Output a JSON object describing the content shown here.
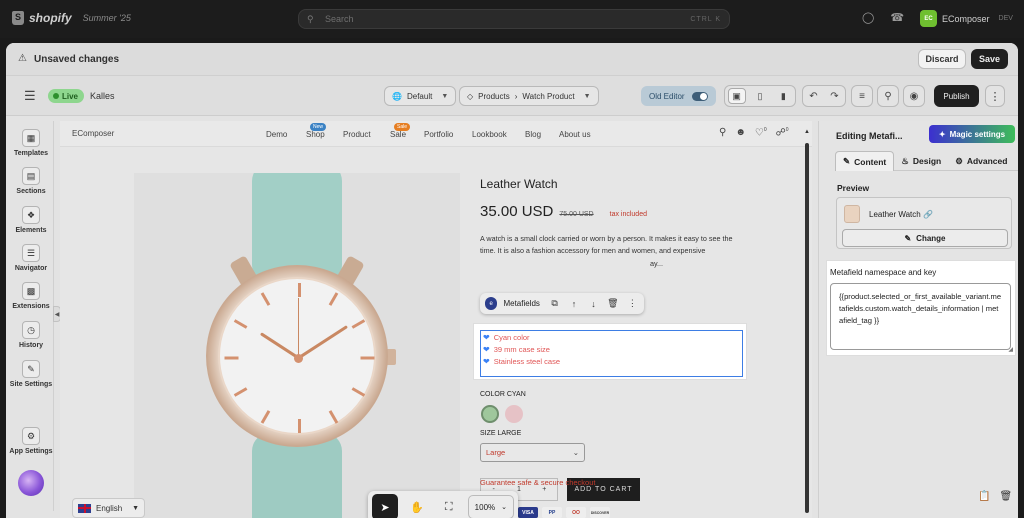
{
  "shopify": {
    "logo_text": "shopify",
    "logo_sub": "Summer '25",
    "search_placeholder": "Search",
    "search_hint": "CTRL K",
    "store_badge": "EC",
    "store_name": "EComposer",
    "store_sub": "DEV"
  },
  "unsaved": {
    "text": "Unsaved changes",
    "discard_label": "Discard",
    "save_label": "Save"
  },
  "toolbar": {
    "live_label": "Live",
    "theme_name": "Kalles",
    "template_label": "Default",
    "breadcrumb_type": "Products",
    "breadcrumb_page": "Watch Product",
    "old_editor_label": "Old Editor",
    "publish_label": "Publish"
  },
  "sidebar": {
    "items": [
      {
        "label": "Templates",
        "icon": "templates-icon"
      },
      {
        "label": "Sections",
        "icon": "sections-icon"
      },
      {
        "label": "Elements",
        "icon": "elements-icon"
      },
      {
        "label": "Navigator",
        "icon": "navigator-icon"
      },
      {
        "label": "Extensions",
        "icon": "extensions-icon"
      },
      {
        "label": "History",
        "icon": "history-icon"
      },
      {
        "label": "Site Settings",
        "icon": "site-settings-icon"
      },
      {
        "label": "App Settings",
        "icon": "app-settings-icon"
      }
    ]
  },
  "site": {
    "brand": "EComposer",
    "nav": [
      {
        "label": "Demo"
      },
      {
        "label": "Shop",
        "badge": "New",
        "badge_color": "#3b82c4"
      },
      {
        "label": "Product"
      },
      {
        "label": "Sale",
        "badge": "Sale",
        "badge_color": "#e67e22"
      },
      {
        "label": "Portfolio"
      },
      {
        "label": "Lookbook"
      },
      {
        "label": "Blog"
      },
      {
        "label": "About us"
      }
    ],
    "wishlist_count": "0",
    "cart_count": "0",
    "language": "English"
  },
  "product": {
    "title": "Leather Watch",
    "price": "35.00 USD",
    "old_price": "75.00 USD",
    "tax": "tax included",
    "description": "A watch is a small clock carried or worn by a person. It makes it easy to see the time. It is also a fashion accessory for men and women, and expensive",
    "description_more": "ay...",
    "metafields_label": "Metafields",
    "metafield_items": [
      "Cyan color",
      "39 mm case size",
      "Stainless steel case"
    ],
    "color_label": "COLOR CYAN",
    "swatch_colors": [
      "#9fc79c",
      "#e6c2c6"
    ],
    "size_label": "SIZE LARGE",
    "size_value": "Large",
    "qty_value": "1",
    "qty_minus": "-",
    "qty_plus": "+",
    "add_to_cart": "ADD TO CART",
    "pay_methods": [
      "VISA",
      "PP",
      "OO",
      "DISCOVER"
    ],
    "guarantee": "Guarantee safe & secure checkout"
  },
  "canvas_tools": {
    "zoom": "100%"
  },
  "right_panel": {
    "title": "Editing Metafi...",
    "magic_label": "Magic settings",
    "tabs": [
      {
        "label": "Content",
        "icon": "pencil-icon",
        "active": true
      },
      {
        "label": "Design",
        "icon": "paint-bucket-icon",
        "active": false
      },
      {
        "label": "Advanced",
        "icon": "gear-icon",
        "active": false
      }
    ],
    "preview_label": "Preview",
    "preview_product": "Leather Watch",
    "change_label": "Change",
    "metafield_label": "Metafield namespace and key",
    "metafield_value": "{{product.selected_or_first_available_variant.metafields.custom.watch_details_information | metafield_tag }}"
  }
}
